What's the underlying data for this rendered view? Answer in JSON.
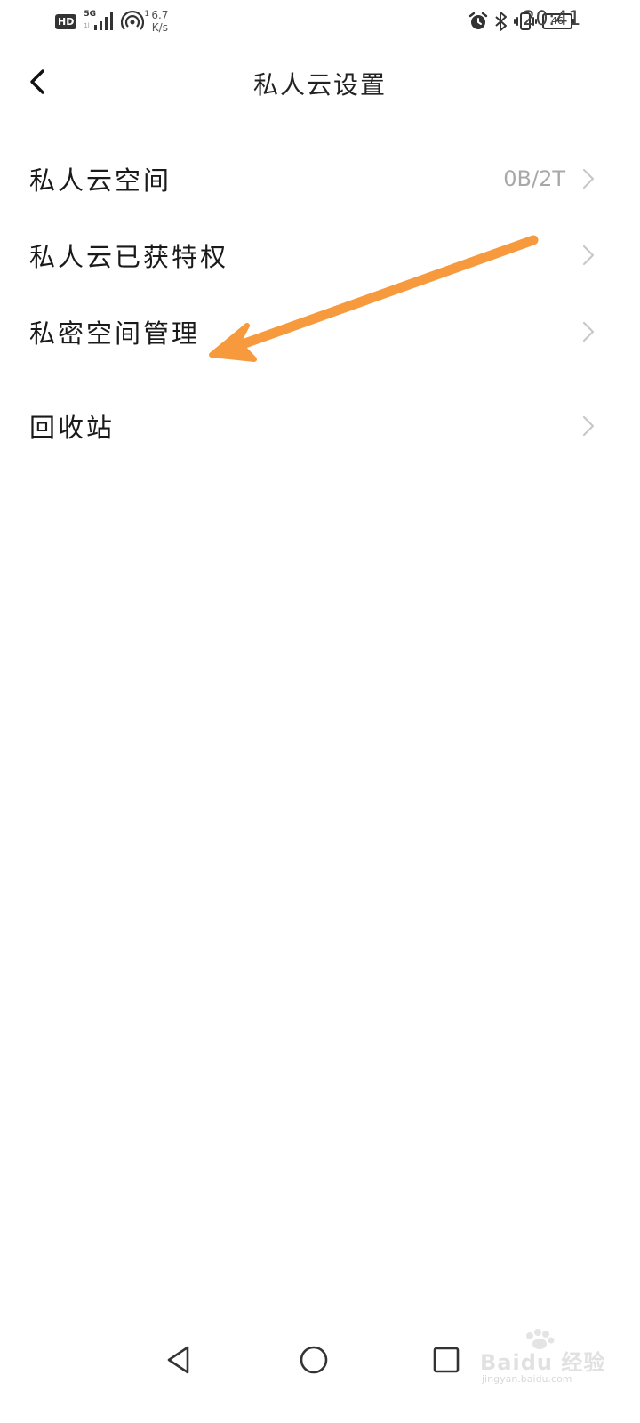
{
  "status_bar": {
    "hd_label": "HD",
    "network_label": "5G",
    "network_sub": "1l",
    "hotspot_sup": "1",
    "speed_value": "6.7",
    "speed_unit": "K/s",
    "battery_level": "46",
    "time": "20:41",
    "icons": [
      "hd-icon",
      "signal-icon",
      "hotspot-icon",
      "alarm-icon",
      "bluetooth-icon",
      "vibrate-icon",
      "battery-icon"
    ]
  },
  "header": {
    "title": "私人云设置",
    "back_icon": "chevron-left-icon"
  },
  "settings": {
    "items": [
      {
        "label": "私人云空间",
        "value": "0B/2T"
      },
      {
        "label": "私人云已获特权",
        "value": ""
      },
      {
        "label": "私密空间管理",
        "value": ""
      },
      {
        "label": "回收站",
        "value": ""
      }
    ]
  },
  "annotation": {
    "color": "#f79a3e",
    "icon": "arrow-icon"
  },
  "nav_bar": {
    "icons": [
      "nav-back-icon",
      "nav-home-icon",
      "nav-recent-icon"
    ]
  },
  "watermark": {
    "text": "Baidu 经验",
    "sub": "jingyan.baidu.com"
  },
  "colors": {
    "background": "#ffffff",
    "text": "#1a1a1a",
    "secondary_text": "#a8a8a8",
    "chevron": "#c8c8c8"
  }
}
